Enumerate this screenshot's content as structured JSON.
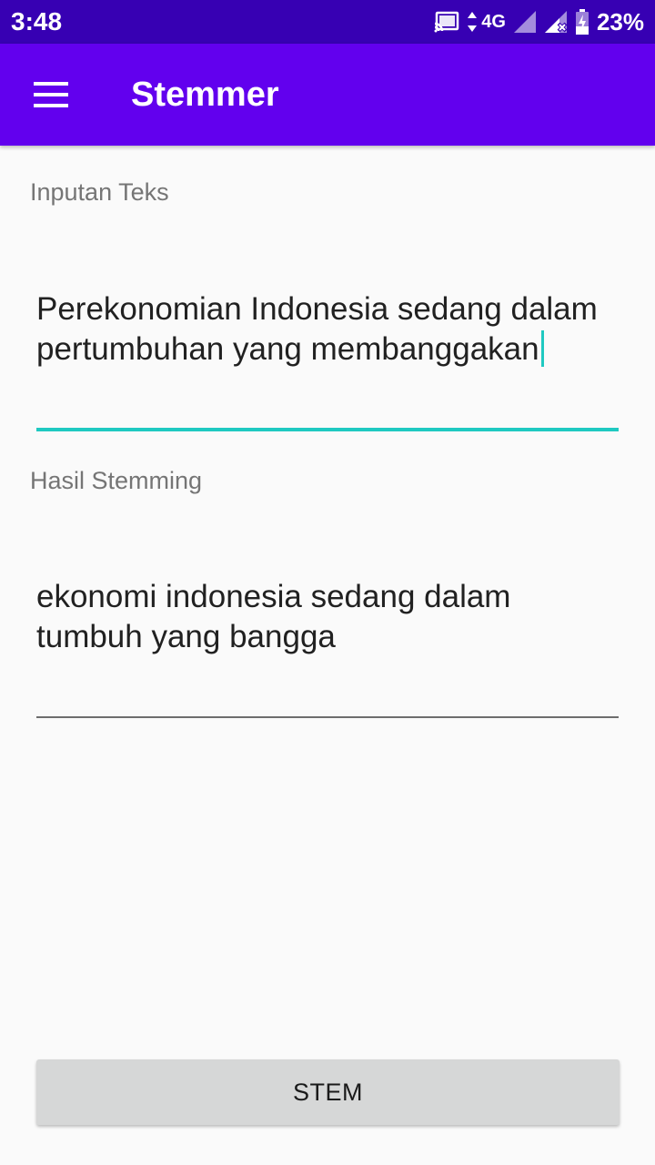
{
  "status_bar": {
    "time": "3:48",
    "network": "4G",
    "battery": "23%",
    "icons": [
      "cast-icon",
      "data-arrows-icon",
      "signal-icon",
      "signal-x-icon",
      "battery-charging-icon"
    ]
  },
  "app_bar": {
    "title": "Stemmer",
    "menu_icon": "hamburger-menu-icon",
    "color": "#6200ee"
  },
  "input_field": {
    "label": "Inputan Teks",
    "value": "Perekonomian Indonesia sedang dalam pertumbuhan yang membanggakan",
    "accent": "#1fc9c1"
  },
  "output_field": {
    "label": "Hasil Stemming",
    "value": "ekonomi indonesia sedang dalam tumbuh yang bangga"
  },
  "action": {
    "stem_label": "STEM"
  }
}
